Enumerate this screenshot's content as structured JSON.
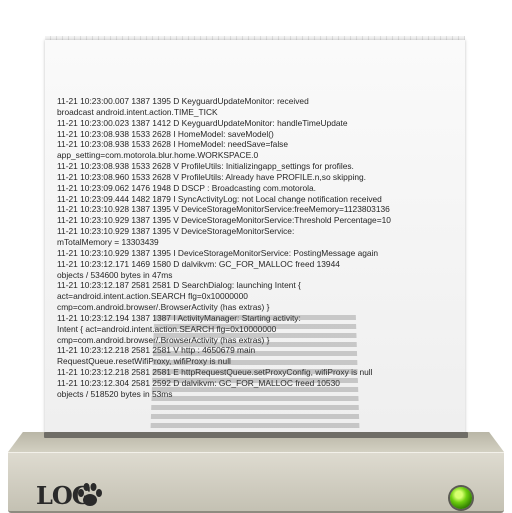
{
  "logo": {
    "text": "LOG"
  },
  "log_lines": [
    "11-21 10:23:00.007  1387   1395 D KeyguardUpdateMonitor: received",
    "broadcast android.intent.action.TIME_TICK",
    "11-21 10:23:00.023  1387   1412 D KeyguardUpdateMonitor: handleTimeUpdate",
    "11-21 10:23:08.938  1533   2628 I HomeModel: saveModel()",
    "11-21 10:23:08.938  1533   2628 I HomeModel: needSave=false",
    "app_setting=com.motorola.blur.home.WORKSPACE.0",
    "11-21 10:23:08.938  1533   2628 V ProfileUtils: Initializingapp_settings for profiles.",
    "11-21 10:23:08.960  1533   2628 V ProfileUtils: Already have PROFILE.n,so skipping.",
    "11-21 10:23:09.062  1476   1948 D DSCP    : Broadcasting com.motorola.",
    "11-21 10:23:09.444  1482   1879 I SyncActivityLog: not Local change notification received",
    "11-21 10:23:10.928  1387   1395 V DeviceStorageMonitorService:freeMemory=1123803136",
    "11-21 10:23:10.929  1387   1395 V DeviceStorageMonitorService:Threshold Percentage=10",
    "11-21 10:23:10.929  1387   1395 V DeviceStorageMonitorService:",
    "mTotalMemory = 13303439",
    "11-21 10:23:10.929  1387   1395 I DeviceStorageMonitorService: PostingMessage again",
    "11-21 10:23:12.171  1469   1580 D dalvikvm: GC_FOR_MALLOC freed 13944",
    "objects / 534600 bytes in 47ms",
    "11-21 10:23:12.187  2581   2581 D SearchDialog: launching Intent {",
    "act=android.intent.action.SEARCH flg=0x10000000",
    "cmp=com.android.browser/.BrowserActivity (has extras) }",
    "11-21 10:23:12.194  1387   1387 I ActivityManager: Starting activity:",
    "Intent { act=android.intent.action.SEARCH flg=0x10000000",
    "cmp=com.android.browser/.BrowserActivity (has extras) }",
    "11-21 10:23:12.218  2581   2581 V http    : 4650679 main",
    "RequestQueue.resetWifiProxy, wifiProxy is null",
    "11-21 10:23:12.218  2581   2581 E httpRequestQueue.setProxyConfig, wifiProxy is null",
    "11-21 10:23:12.304  2581   2592 D dalvikvm: GC_FOR_MALLOC freed 10530",
    "objects / 518520 bytes in 53ms"
  ],
  "colors": {
    "led": "#6fcf10",
    "paper": "#f5f5f5",
    "base": "#d3d0c2"
  }
}
